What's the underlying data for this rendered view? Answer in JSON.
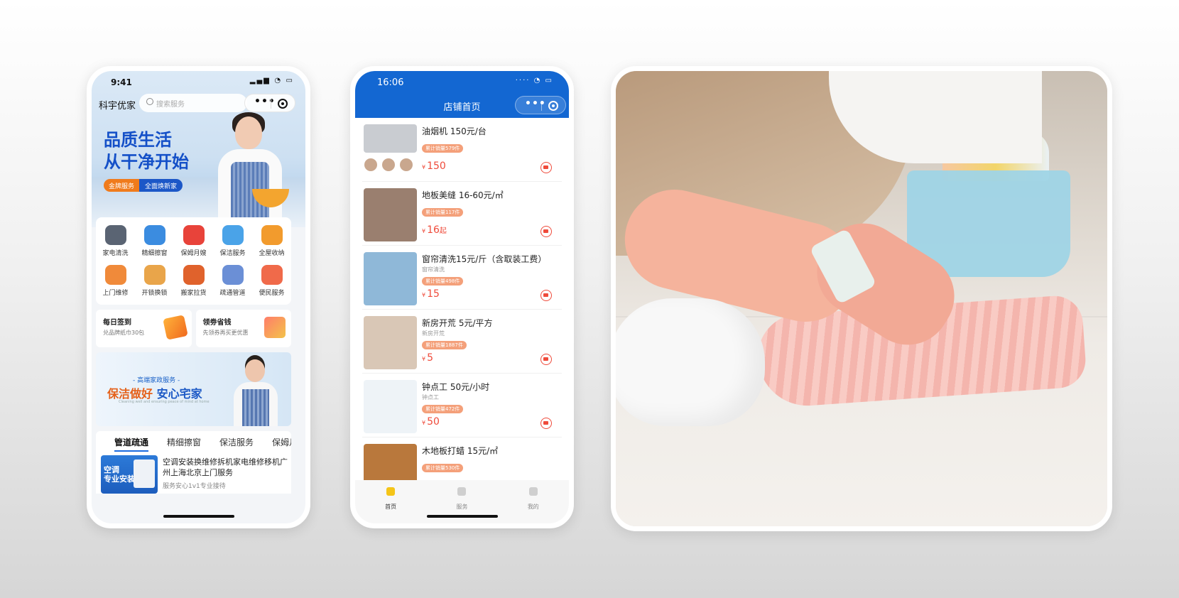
{
  "phone1": {
    "status_time": "9:41",
    "brand": "科宇优家",
    "search_placeholder": "搜索服务",
    "headline_line1": "品质生活",
    "headline_line2": "从干净开始",
    "tag_gold": "金牌服务",
    "tag_new": "全面焕新家",
    "categories": [
      {
        "label": "家电清洗",
        "color": "#5a6473"
      },
      {
        "label": "精细擦窗",
        "color": "#3b8ce0"
      },
      {
        "label": "保姆月嫂",
        "color": "#e8433a"
      },
      {
        "label": "保洁服务",
        "color": "#4aa3e8"
      },
      {
        "label": "全屋收纳",
        "color": "#f29b2d"
      },
      {
        "label": "上门维修",
        "color": "#f08a3a"
      },
      {
        "label": "开锁换锁",
        "color": "#e9a54a"
      },
      {
        "label": "搬家拉货",
        "color": "#e0622c"
      },
      {
        "label": "疏通管道",
        "color": "#6b8fd6"
      },
      {
        "label": "便民服务",
        "color": "#f06a4a"
      }
    ],
    "card_signin": {
      "title": "每日签到",
      "subtitle": "兑品牌纸巾30包"
    },
    "card_coupon": {
      "title": "领劵省钱",
      "subtitle": "先领券再买更优惠"
    },
    "banner_small": "- 高端家政服务 -",
    "banner_big_a": "保洁做好",
    "banner_big_b": "安心宅家",
    "banner_en": "Cleaning well and ensuring peace of mind at home",
    "tabs": [
      "管道疏通",
      "精细擦窗",
      "保洁服务",
      "保姆月"
    ],
    "item_thumb_text": "空调\n专业安装",
    "item_title": "空调安装换维修拆机家电维修移机广州上海北京上门服务",
    "item_sub": "服务安心1v1专业接待"
  },
  "phone2": {
    "status_time": "16:06",
    "title": "店铺首页",
    "currency": "¥",
    "products": [
      {
        "name": "油烟机 150元/台",
        "tag": "",
        "sales": "累计销量579件",
        "price": "150",
        "suffix": "",
        "img": "#c9ccd1"
      },
      {
        "name": "地板美缝 16-60元/㎡",
        "tag": "",
        "sales": "累计销量117件",
        "price": "16",
        "suffix": "起",
        "img": "#9a7f6f"
      },
      {
        "name": "窗帘清洗15元/斤（含取装工费）",
        "tag": "窗帘清洗",
        "sales": "累计销量498件",
        "price": "15",
        "suffix": "",
        "img": "#8fb8d8"
      },
      {
        "name": "新房开荒 5元/平方",
        "tag": "新房开荒",
        "sales": "累计销量1887件",
        "price": "5",
        "suffix": "",
        "img": "#d9c7b6"
      },
      {
        "name": "钟点工 50元/小时",
        "tag": "钟点工",
        "sales": "累计销量472件",
        "price": "50",
        "suffix": "",
        "img": "#eef3f7"
      },
      {
        "name": "木地板打蜡 15元/㎡",
        "tag": "",
        "sales": "累计销量530件",
        "price": "",
        "suffix": "",
        "img": "#b9783c"
      }
    ],
    "tabbar": [
      {
        "label": "首页",
        "active": true
      },
      {
        "label": "服务",
        "active": false
      },
      {
        "label": "我的",
        "active": false
      }
    ]
  }
}
